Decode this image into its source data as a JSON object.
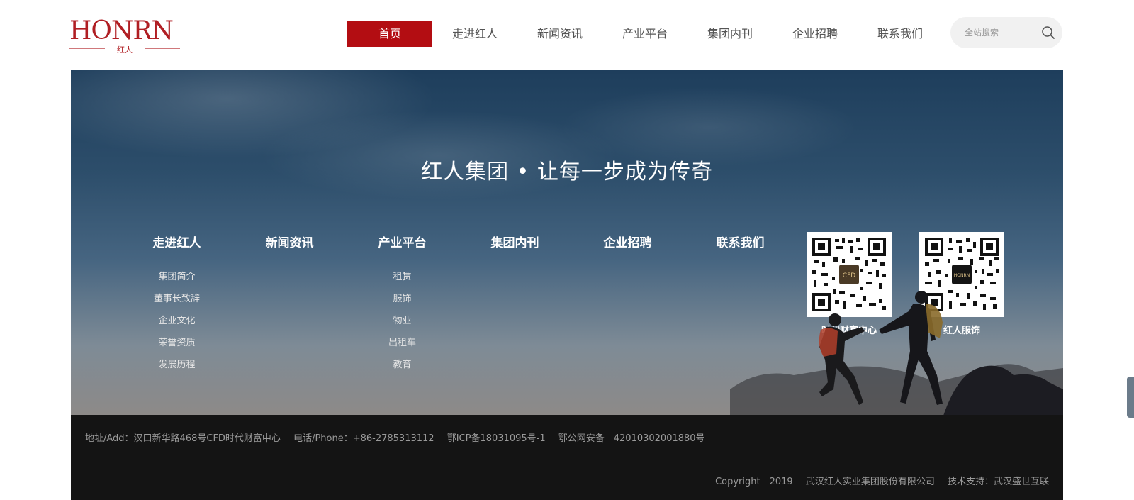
{
  "header": {
    "logo_main": "HONRN",
    "logo_sub": "红人",
    "nav": [
      {
        "label": "首页",
        "active": true
      },
      {
        "label": "走进红人",
        "active": false
      },
      {
        "label": "新闻资讯",
        "active": false
      },
      {
        "label": "产业平台",
        "active": false
      },
      {
        "label": "集团内刊",
        "active": false
      },
      {
        "label": "企业招聘",
        "active": false
      },
      {
        "label": "联系我们",
        "active": false
      }
    ],
    "search_placeholder": "全站搜索"
  },
  "banner": {
    "slogan": "红人集团 • 让每一步成为传奇",
    "columns": [
      {
        "title": "走进红人",
        "links": [
          "集团简介",
          "董事长致辞",
          "企业文化",
          "荣誉资质",
          "发展历程"
        ]
      },
      {
        "title": "新闻资讯",
        "links": []
      },
      {
        "title": "产业平台",
        "links": [
          "租赁",
          "服饰",
          "物业",
          "出租车",
          "教育"
        ]
      },
      {
        "title": "集团内刊",
        "links": []
      },
      {
        "title": "企业招聘",
        "links": []
      },
      {
        "title": "联系我们",
        "links": []
      }
    ],
    "qrcodes": [
      {
        "label": "时代财富中心",
        "center_text": "CFD"
      },
      {
        "label": "红人服饰",
        "center_text": "HONRN"
      }
    ]
  },
  "footer": {
    "address": "地址/Add：汉口新华路468号CFD时代财富中心",
    "phone": "电话/Phone：+86-2785313112",
    "icp": "鄂ICP备18031095号-1",
    "police": "鄂公网安备　42010302001880号",
    "copyright": "Copyright　2019",
    "company": "武汉红人实业集团股份有限公司",
    "support": "技术支持：武汉盛世互联"
  },
  "colors": {
    "brand": "#b30d12",
    "footer_bg": "#141414"
  }
}
